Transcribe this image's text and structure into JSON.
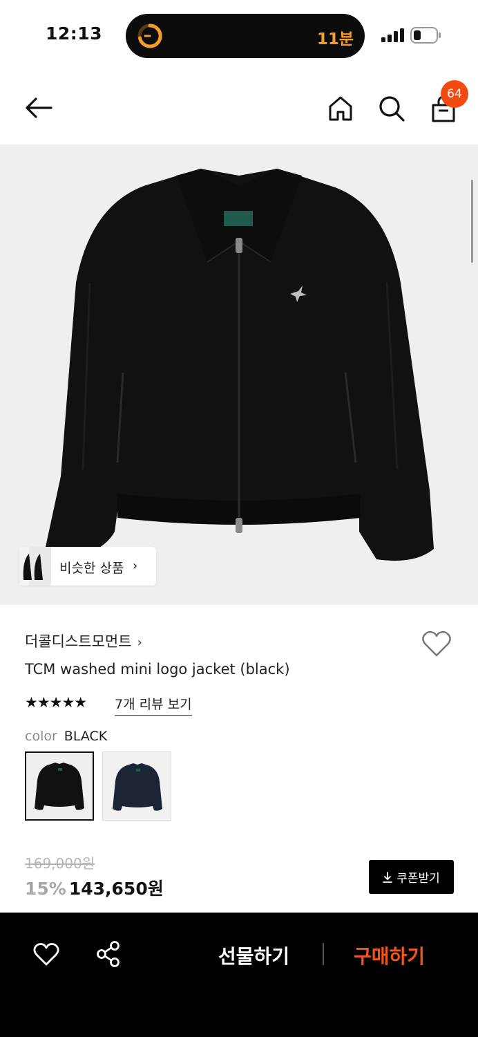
{
  "status_bar": {
    "time": "12:13",
    "timer_text": "11분",
    "timer_color": "#f29b2e"
  },
  "nav": {
    "back_icon": "arrow-left-icon",
    "home_icon": "home-icon",
    "search_icon": "search-icon",
    "cart_icon": "shopping-bag-icon",
    "cart_count": "64",
    "badge_color": "#f24a13"
  },
  "hero": {
    "image": "black-jacket-photo",
    "similar_label": "비슷한 상품",
    "similar_chevron": "›"
  },
  "product": {
    "brand": "더콜디스트모먼트",
    "brand_chevron": "›",
    "title": "TCM washed mini logo jacket (black)",
    "stars": "★★★★★",
    "rating": 5,
    "review_link": "7개 리뷰 보기",
    "color_label": "color",
    "color_value": "BLACK",
    "swatches": [
      "BLACK",
      "NAVY"
    ],
    "original_price": "169,000원",
    "discount": "15%",
    "price": "143,650원",
    "coupon_label": "쿠폰받기",
    "coupon_icon": "download-icon"
  },
  "bottom_bar": {
    "like_icon": "heart-icon",
    "share_icon": "share-icon",
    "gift_label": "선물하기",
    "buy_label": "구매하기",
    "buy_color": "#f2561d"
  }
}
